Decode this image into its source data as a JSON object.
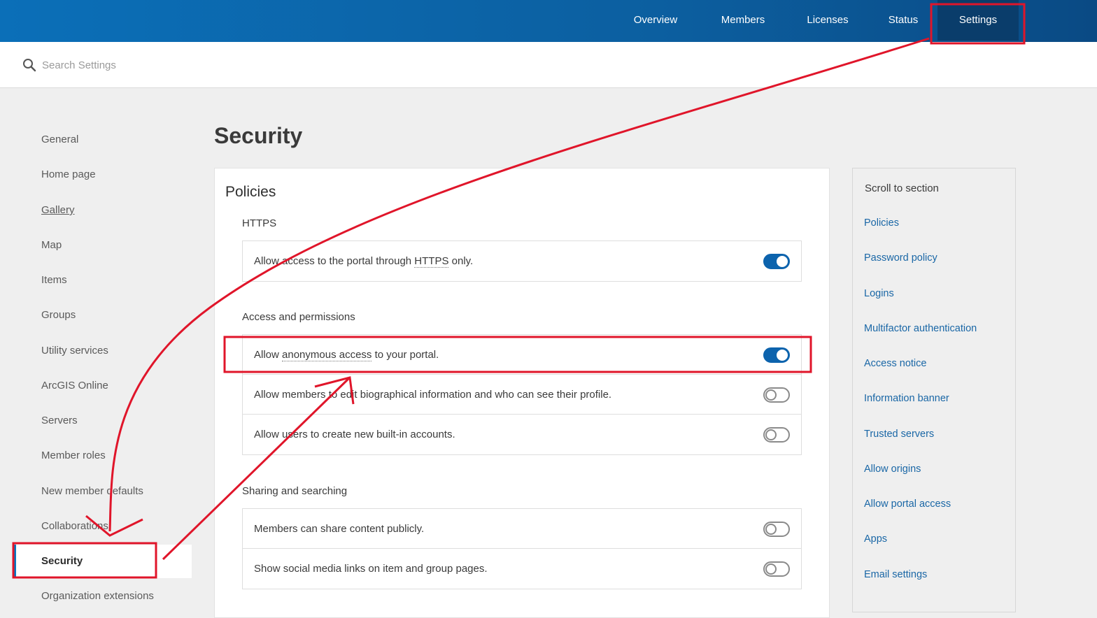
{
  "topnav": {
    "tabs": [
      {
        "label": "Overview"
      },
      {
        "label": "Members"
      },
      {
        "label": "Licenses"
      },
      {
        "label": "Status"
      },
      {
        "label": "Settings"
      }
    ],
    "active_tab": "Settings"
  },
  "search": {
    "placeholder": "Search Settings",
    "value": ""
  },
  "sidebar": {
    "items": [
      {
        "label": "General"
      },
      {
        "label": "Home page"
      },
      {
        "label": "Gallery"
      },
      {
        "label": "Map"
      },
      {
        "label": "Items"
      },
      {
        "label": "Groups"
      },
      {
        "label": "Utility services"
      },
      {
        "label": "ArcGIS Online"
      },
      {
        "label": "Servers"
      },
      {
        "label": "Member roles"
      },
      {
        "label": "New member defaults"
      },
      {
        "label": "Collaborations"
      },
      {
        "label": "Security"
      },
      {
        "label": "Organization extensions"
      }
    ],
    "active_item": "Security"
  },
  "page": {
    "title": "Security"
  },
  "policies": {
    "title": "Policies",
    "https": {
      "title": "HTTPS",
      "settings": [
        {
          "prefix": "Allow access to the portal through ",
          "term": "HTTPS",
          "suffix": " only.",
          "enabled": true
        }
      ]
    },
    "access": {
      "title": "Access and permissions",
      "settings": [
        {
          "prefix": "Allow ",
          "term": "anonymous access",
          "suffix": " to your portal.",
          "enabled": true
        },
        {
          "label": "Allow members to edit biographical information and who can see their profile.",
          "enabled": false
        },
        {
          "label": "Allow users to create new built-in accounts.",
          "enabled": false
        }
      ]
    },
    "sharing": {
      "title": "Sharing and searching",
      "settings": [
        {
          "label": "Members can share content publicly.",
          "enabled": false
        },
        {
          "label": "Show social media links on item and group pages.",
          "enabled": false
        }
      ]
    }
  },
  "scroll_to_section": {
    "title": "Scroll to section",
    "links": [
      {
        "label": "Policies"
      },
      {
        "label": "Password policy"
      },
      {
        "label": "Logins"
      },
      {
        "label": "Multifactor authentication"
      },
      {
        "label": "Access notice"
      },
      {
        "label": "Information banner"
      },
      {
        "label": "Trusted servers"
      },
      {
        "label": "Allow origins"
      },
      {
        "label": "Allow portal access"
      },
      {
        "label": "Apps"
      },
      {
        "label": "Email settings"
      }
    ]
  },
  "colors": {
    "nav_blue": "#0b6fb8",
    "active_tab": "#0a3d6b",
    "toggle_on": "#0c63ad",
    "link": "#1a67a6",
    "annotation_red": "#e0152a"
  }
}
